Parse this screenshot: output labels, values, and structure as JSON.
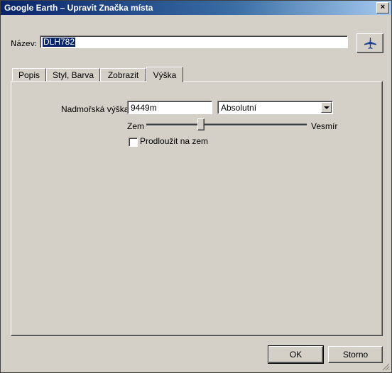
{
  "window": {
    "title": "Google Earth – Upravit Značka místa",
    "close_glyph": "×"
  },
  "name_row": {
    "label": "Název:",
    "value": "DLH782",
    "icon": "airplane-icon"
  },
  "tabs": [
    {
      "label": "Popis",
      "active": false
    },
    {
      "label": "Styl, Barva",
      "active": false
    },
    {
      "label": "Zobrazit",
      "active": false
    },
    {
      "label": "Výška",
      "active": true
    }
  ],
  "altitude": {
    "label": "Nadmořská výška:",
    "value": "9449m",
    "mode_selected": "Absolutní",
    "slider_min_label": "Zem",
    "slider_max_label": "Vesmír",
    "slider_level": 0.34,
    "extend_label": "Prodloužit na zem",
    "extend_checked": false
  },
  "buttons": {
    "ok": "OK",
    "cancel": "Storno"
  },
  "colors": {
    "title_bar": "#0a246a",
    "selection": "#0a246a",
    "face": "#d4d0c8",
    "airplane": "#1f3f8f"
  }
}
